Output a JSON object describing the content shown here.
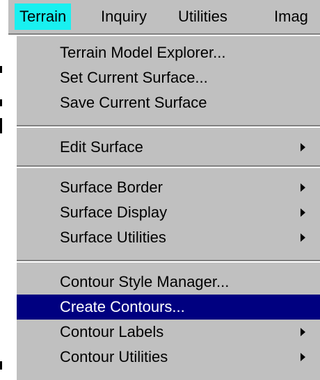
{
  "menubar": {
    "items": [
      {
        "label": "Terrain",
        "active": true
      },
      {
        "label": "Inquiry",
        "active": false
      },
      {
        "label": "Utilities",
        "active": false
      },
      {
        "label": "Imag",
        "active": false
      }
    ]
  },
  "terrain_menu": {
    "items": [
      {
        "label": "Terrain Model Explorer...",
        "submenu": false
      },
      {
        "label": "Set Current Surface...",
        "submenu": false
      },
      {
        "label": "Save Current Surface",
        "submenu": false
      },
      {
        "label": "Edit Surface",
        "submenu": true
      },
      {
        "label": "Surface Border",
        "submenu": true
      },
      {
        "label": "Surface Display",
        "submenu": true
      },
      {
        "label": "Surface Utilities",
        "submenu": true
      },
      {
        "label": "Contour Style Manager...",
        "submenu": false
      },
      {
        "label": "Create Contours...",
        "submenu": false,
        "highlighted": true
      },
      {
        "label": "Contour Labels",
        "submenu": true
      },
      {
        "label": "Contour Utilities",
        "submenu": true
      }
    ]
  },
  "colors": {
    "menu_background": "#c0c0c0",
    "active_menubar_item": "#19f0f0",
    "highlight": "#000080"
  }
}
